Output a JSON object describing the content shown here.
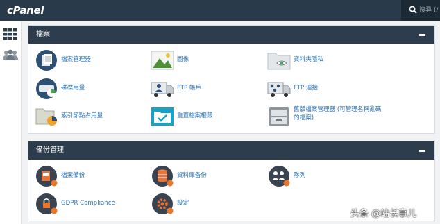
{
  "header": {
    "logo": "cPanel",
    "search_placeholder": "搜尋 (/"
  },
  "sidebar": {
    "items": [
      {
        "icon": "grid-icon"
      },
      {
        "icon": "users-icon"
      }
    ]
  },
  "files": {
    "title": "檔案",
    "items": [
      {
        "label": "檔案管理器",
        "icon": "file-manager-icon"
      },
      {
        "label": "圖像",
        "icon": "images-icon"
      },
      {
        "label": "資料夾隱私",
        "icon": "directory-privacy-icon"
      },
      {
        "label": "磁碟用量",
        "icon": "disk-usage-icon"
      },
      {
        "label": "FTP 帳戶",
        "icon": "ftp-accounts-icon"
      },
      {
        "label": "FTP 連接",
        "icon": "ftp-connections-icon"
      },
      {
        "label": "索引節點占用量",
        "icon": "inode-usage-icon"
      },
      {
        "label": "重置檔案權限",
        "icon": "reset-permissions-icon"
      },
      {
        "label": "舊版檔案管理器 (可管理名稱亂碼的檔案)",
        "icon": "legacy-file-manager-icon"
      }
    ]
  },
  "backup": {
    "title": "備份管理",
    "items": [
      {
        "label": "檔案備份",
        "icon": "file-backup-icon"
      },
      {
        "label": "資料庫备份",
        "icon": "database-backup-icon"
      },
      {
        "label": "隊列",
        "icon": "queue-icon"
      },
      {
        "label": "GDPR Compliance",
        "icon": "gdpr-icon"
      },
      {
        "label": "設定",
        "icon": "settings-icon"
      }
    ]
  },
  "watermark": "头条 @站长事儿",
  "colors": {
    "topbar": "#293a4a",
    "panel_header": "#2e3d4d",
    "link": "#2c76b8",
    "badge": "#e8772e"
  }
}
